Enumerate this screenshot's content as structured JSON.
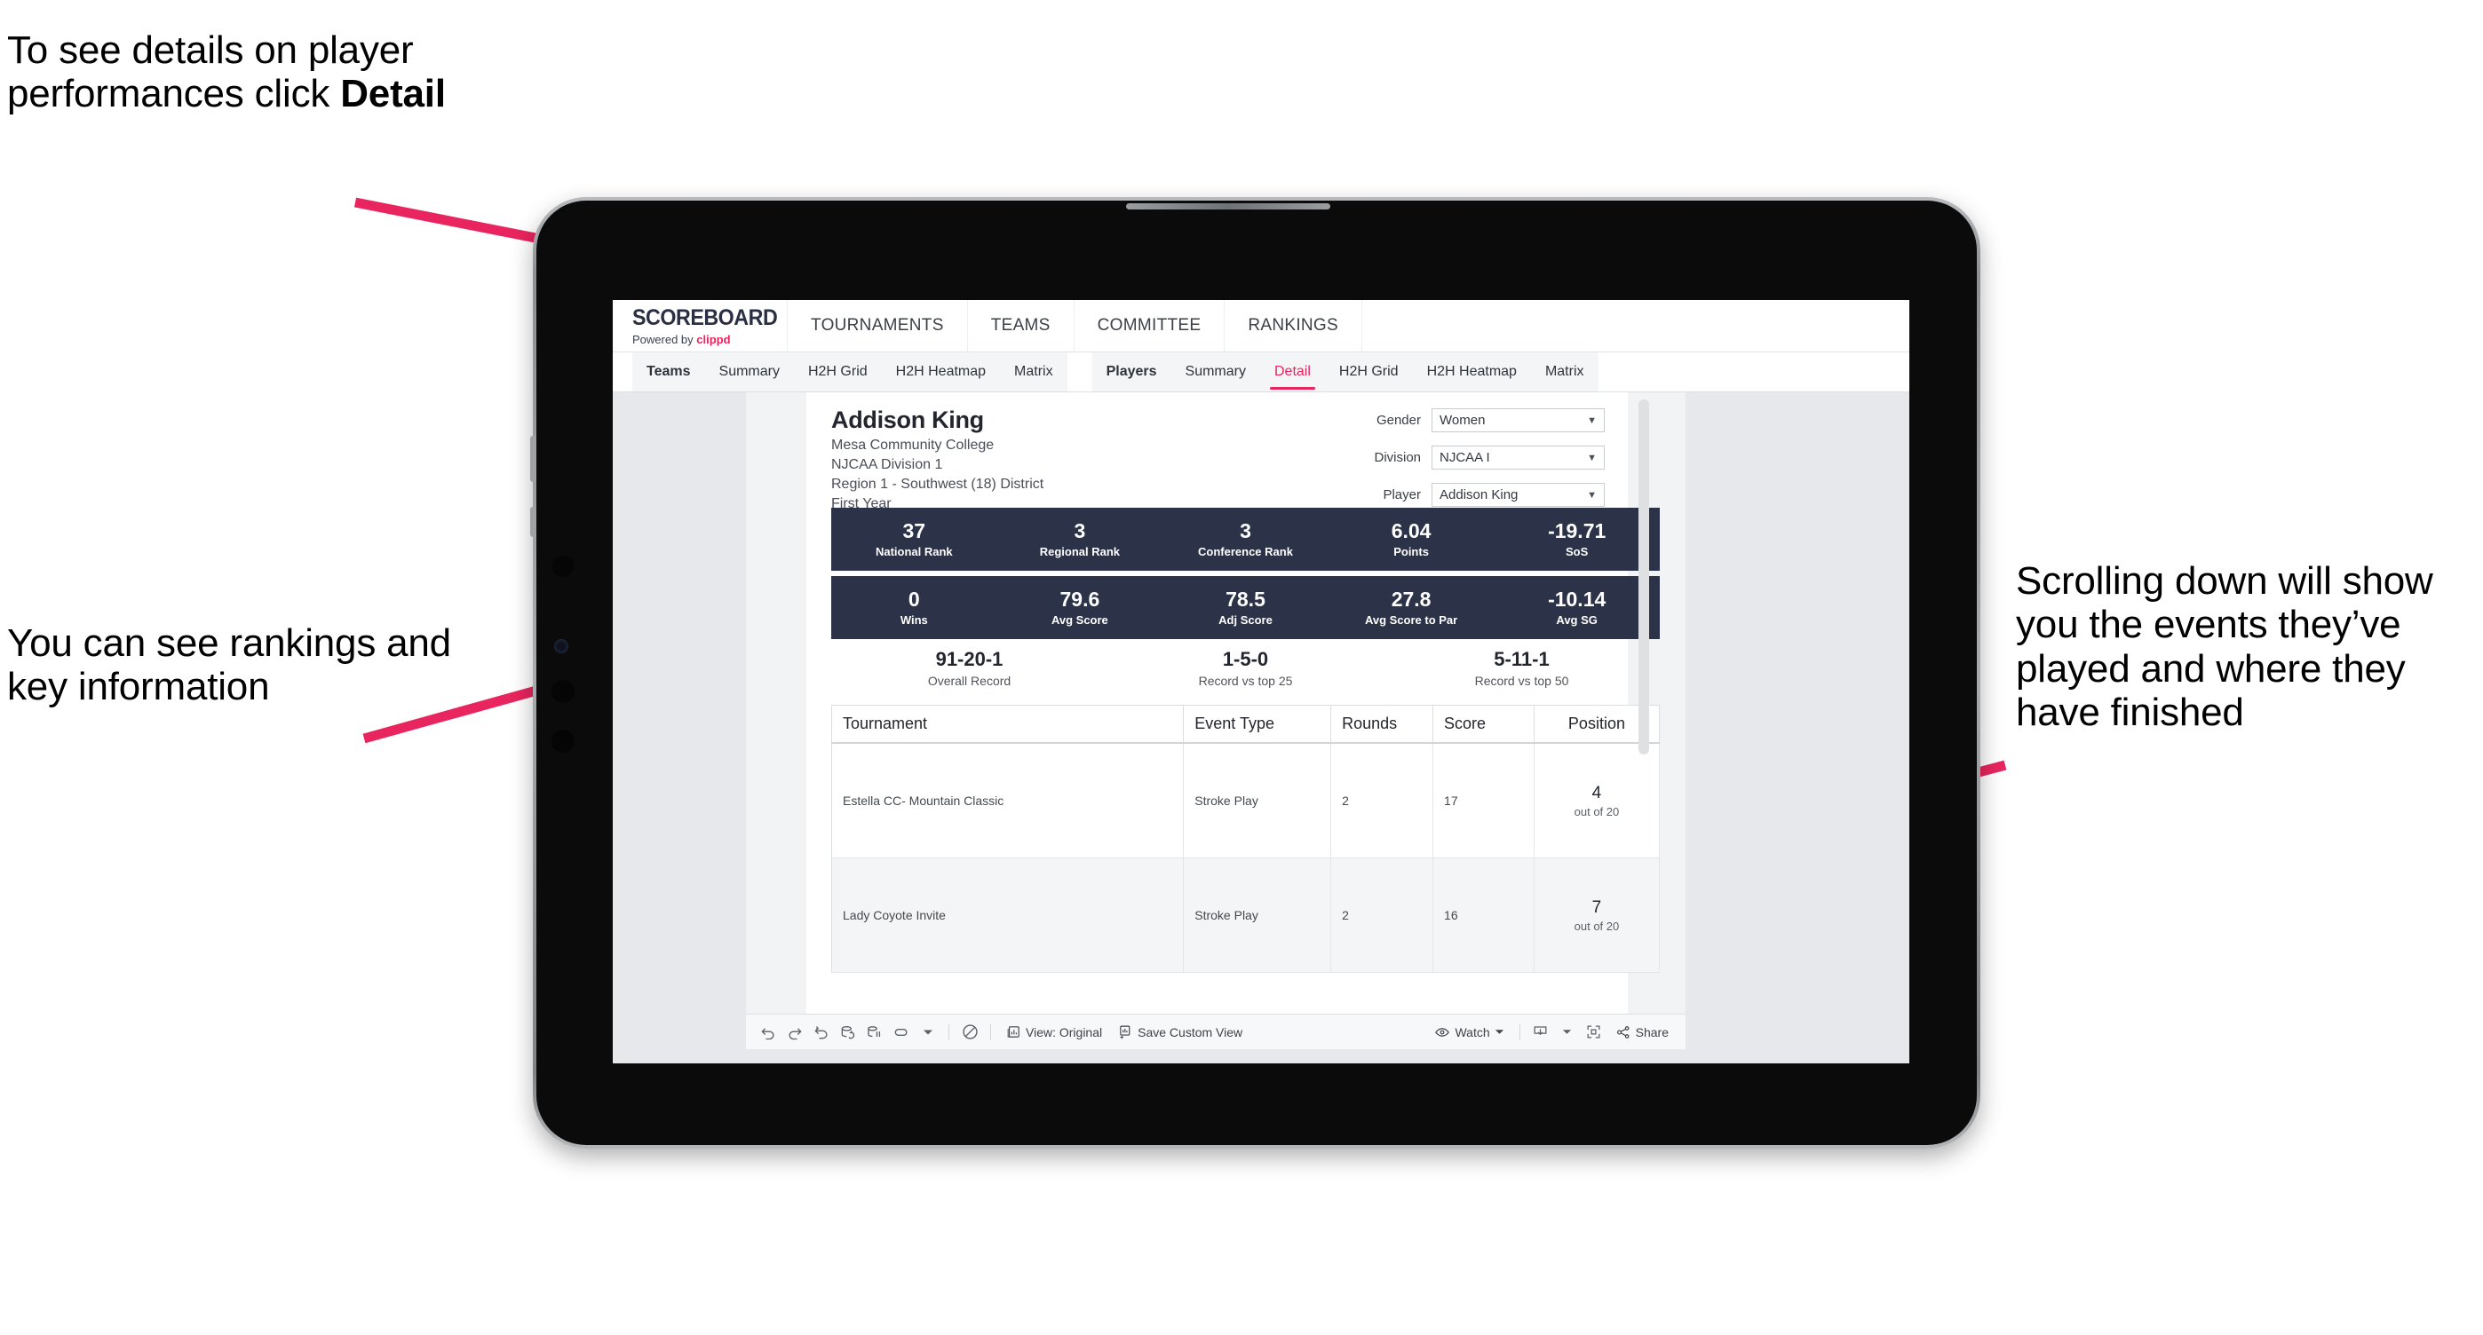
{
  "annotations": {
    "top_left": "To see details on player performances click ",
    "top_left_bold": "Detail",
    "mid_left": "You can see rankings and key information",
    "right": "Scrolling down will show you the events they’ve played and where they have finished",
    "arrow_color": "#e8255e"
  },
  "app": {
    "brand": {
      "title": "SCOREBOARD",
      "powered_prefix": "Powered by ",
      "powered_brand": "clippd"
    },
    "top_nav": [
      "TOURNAMENTS",
      "TEAMS",
      "COMMITTEE",
      "RANKINGS"
    ],
    "sub_nav": {
      "group_teams": [
        "Teams",
        "Summary",
        "H2H Grid",
        "H2H Heatmap",
        "Matrix"
      ],
      "group_players": [
        "Players",
        "Summary",
        "Detail",
        "H2H Grid",
        "H2H Heatmap",
        "Matrix"
      ],
      "active_tab": "Detail"
    }
  },
  "player": {
    "name": "Addison King",
    "school": "Mesa Community College",
    "division": "NJCAA Division 1",
    "region": "Region 1 - Southwest (18) District",
    "year": "First Year"
  },
  "filters": [
    {
      "label": "Gender",
      "value": "Women"
    },
    {
      "label": "Division",
      "value": "NJCAA I"
    },
    {
      "label": "Player",
      "value": "Addison King"
    }
  ],
  "stats_row_1": [
    {
      "value": "37",
      "label": "National Rank"
    },
    {
      "value": "3",
      "label": "Regional Rank"
    },
    {
      "value": "3",
      "label": "Conference Rank"
    },
    {
      "value": "6.04",
      "label": "Points"
    },
    {
      "value": "-19.71",
      "label": "SoS"
    }
  ],
  "stats_row_2": [
    {
      "value": "0",
      "label": "Wins"
    },
    {
      "value": "79.6",
      "label": "Avg Score"
    },
    {
      "value": "78.5",
      "label": "Adj Score"
    },
    {
      "value": "27.8",
      "label": "Avg Score to Par"
    },
    {
      "value": "-10.14",
      "label": "Avg SG"
    }
  ],
  "records": [
    {
      "value": "91-20-1",
      "label": "Overall Record"
    },
    {
      "value": "1-5-0",
      "label": "Record vs top 25"
    },
    {
      "value": "5-11-1",
      "label": "Record vs top 50"
    }
  ],
  "events_table": {
    "columns": [
      "Tournament",
      "Event Type",
      "Rounds",
      "Score",
      "Position"
    ],
    "rows": [
      {
        "tournament": "Estella CC- Mountain Classic",
        "event_type": "Stroke Play",
        "rounds": "2",
        "score": "17",
        "position": "4",
        "position_sub": "out of 20"
      },
      {
        "tournament": "Lady Coyote Invite",
        "event_type": "Stroke Play",
        "rounds": "2",
        "score": "16",
        "position": "7",
        "position_sub": "out of 20"
      }
    ]
  },
  "toolbar": {
    "view_label": "View: Original",
    "save_label": "Save Custom View",
    "watch_label": "Watch",
    "share_label": "Share"
  },
  "colors": {
    "accent": "#e8255e",
    "stat_bar": "#2c3248",
    "chrome": "#ffffff"
  }
}
